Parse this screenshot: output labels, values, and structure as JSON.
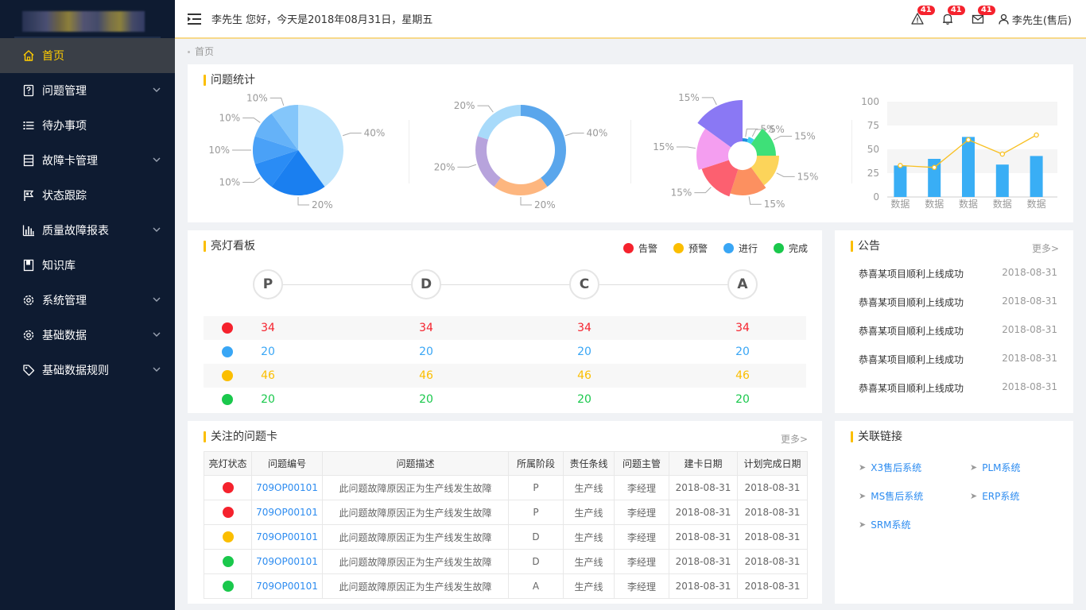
{
  "logo": {
    "image": "blurred-company-logo"
  },
  "sidebar": {
    "items": [
      {
        "label": "首页",
        "icon": "home-icon",
        "active": true,
        "expandable": false
      },
      {
        "label": "问题管理",
        "icon": "question-doc-icon",
        "expandable": true
      },
      {
        "label": "待办事项",
        "icon": "list-icon",
        "expandable": false
      },
      {
        "label": "故障卡管理",
        "icon": "card-icon",
        "expandable": true
      },
      {
        "label": "状态跟踪",
        "icon": "flag-icon",
        "expandable": false
      },
      {
        "label": "质量故障报表",
        "icon": "bar-chart-icon",
        "expandable": true
      },
      {
        "label": "知识库",
        "icon": "book-icon",
        "expandable": false
      },
      {
        "label": "系统管理",
        "icon": "gear-icon",
        "expandable": true
      },
      {
        "label": "基础数据",
        "icon": "gear-icon",
        "expandable": true
      },
      {
        "label": "基础数据规则",
        "icon": "tag-icon",
        "expandable": true
      }
    ]
  },
  "header": {
    "greeting": "李先生 您好，今天是2018年08月31日，星期五",
    "badges": {
      "alerts": "41",
      "notifications": "41",
      "messages": "41"
    },
    "user": "李先生(售后)"
  },
  "breadcrumb": "首页",
  "stats": {
    "title": "问题统计",
    "chart_data": [
      {
        "type": "pie",
        "values": [
          40,
          20,
          10,
          10,
          10,
          10
        ],
        "labels": [
          "40%",
          "20%",
          "10%",
          "10%",
          "10%",
          "10%"
        ],
        "colors": [
          "#bde4fc",
          "#1a7ff0",
          "#2a8cf5",
          "#4aa1f7",
          "#65b2f8",
          "#84c6fa"
        ]
      },
      {
        "type": "pie",
        "variant": "donut",
        "values": [
          40,
          20,
          20,
          20
        ],
        "labels": [
          "40%",
          "20%",
          "20%",
          "20%"
        ],
        "colors": [
          "#5aa6ec",
          "#fdb67f",
          "#b7a3dc",
          "#a8dafa"
        ]
      },
      {
        "type": "pie",
        "variant": "rose",
        "values": [
          5,
          5,
          15,
          15,
          15,
          15,
          15,
          15
        ],
        "labels": [
          "5%",
          "5%",
          "15%",
          "15%",
          "15%",
          "15%",
          "15%",
          "15%"
        ],
        "colors": [
          "#1e90e0",
          "#3bd0ee",
          "#3ee078",
          "#fcd45a",
          "#fc9060",
          "#fc6070",
          "#f49ef0",
          "#8a78f4"
        ]
      },
      {
        "type": "bar",
        "categories": [
          "数据",
          "数据",
          "数据",
          "数据",
          "数据"
        ],
        "series": [
          {
            "type": "bar",
            "values": [
              33,
              40,
              63,
              34,
              43
            ],
            "color": "#39aef5"
          },
          {
            "type": "line",
            "values": [
              33,
              31,
              60,
              45,
              65
            ],
            "color": "#f8c022"
          }
        ],
        "ylim": [
          0,
          100
        ],
        "yticks": [
          "0",
          "25",
          "50",
          "75",
          "100"
        ]
      }
    ]
  },
  "board": {
    "title": "亮灯看板",
    "legend": [
      {
        "label": "告警",
        "color": "#f5222d"
      },
      {
        "label": "预警",
        "color": "#fbbe00"
      },
      {
        "label": "进行",
        "color": "#39a6f5"
      },
      {
        "label": "完成",
        "color": "#1ac84c"
      }
    ],
    "stages": [
      "P",
      "D",
      "C",
      "A"
    ],
    "rows": [
      {
        "color": "#f5222d",
        "values": [
          "34",
          "34",
          "34",
          "34"
        ]
      },
      {
        "color": "#39a6f5",
        "values": [
          "20",
          "20",
          "20",
          "20"
        ]
      },
      {
        "color": "#fbbe00",
        "values": [
          "46",
          "46",
          "46",
          "46"
        ]
      },
      {
        "color": "#1ac84c",
        "values": [
          "20",
          "20",
          "20",
          "20"
        ]
      }
    ]
  },
  "notice": {
    "title": "公告",
    "more": "更多>",
    "items": [
      {
        "text": "恭喜某项目顺利上线成功",
        "date": "2018-08-31"
      },
      {
        "text": "恭喜某项目顺利上线成功",
        "date": "2018-08-31"
      },
      {
        "text": "恭喜某项目顺利上线成功",
        "date": "2018-08-31"
      },
      {
        "text": "恭喜某项目顺利上线成功",
        "date": "2018-08-31"
      },
      {
        "text": "恭喜某项目顺利上线成功",
        "date": "2018-08-31"
      }
    ]
  },
  "cards": {
    "title": "关注的问题卡",
    "more": "更多>",
    "columns": [
      "亮灯状态",
      "问题编号",
      "问题描述",
      "所属阶段",
      "责任条线",
      "问题主管",
      "建卡日期",
      "计划完成日期"
    ],
    "rows": [
      {
        "status_color": "#f5222d",
        "code": "709OP00101",
        "desc": "此问题故障原因正为生产线发生故障",
        "stage": "P",
        "line": "生产线",
        "owner": "李经理",
        "created": "2018-08-31",
        "due": "2018-08-31"
      },
      {
        "status_color": "#f5222d",
        "code": "709OP00101",
        "desc": "此问题故障原因正为生产线发生故障",
        "stage": "P",
        "line": "生产线",
        "owner": "李经理",
        "created": "2018-08-31",
        "due": "2018-08-31"
      },
      {
        "status_color": "#fbbe00",
        "code": "709OP00101",
        "desc": "此问题故障原因正为生产线发生故障",
        "stage": "D",
        "line": "生产线",
        "owner": "李经理",
        "created": "2018-08-31",
        "due": "2018-08-31"
      },
      {
        "status_color": "#1ac84c",
        "code": "709OP00101",
        "desc": "此问题故障原因正为生产线发生故障",
        "stage": "D",
        "line": "生产线",
        "owner": "李经理",
        "created": "2018-08-31",
        "due": "2018-08-31"
      },
      {
        "status_color": "#1ac84c",
        "code": "709OP00101",
        "desc": "此问题故障原因正为生产线发生故障",
        "stage": "A",
        "line": "生产线",
        "owner": "李经理",
        "created": "2018-08-31",
        "due": "2018-08-31"
      }
    ]
  },
  "links": {
    "title": "关联链接",
    "items": [
      "X3售后系统",
      "PLM系统",
      "MS售后系统",
      "ERP系统",
      "SRM系统"
    ]
  }
}
